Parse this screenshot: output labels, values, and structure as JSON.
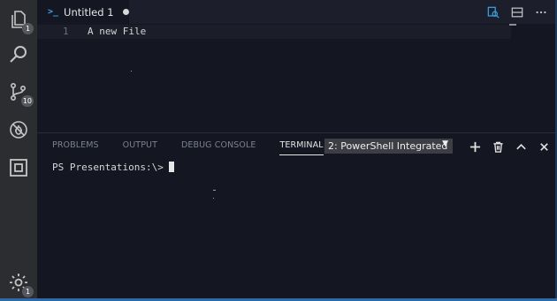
{
  "activity_bar": {
    "explorer_badge": "1",
    "scm_badge": "10",
    "settings_badge": "1"
  },
  "editor": {
    "tab": {
      "label": "Untitled 1",
      "icon": "powershell-icon",
      "dirty": true
    },
    "lines": [
      {
        "number": "1",
        "text": "A new File"
      }
    ]
  },
  "panel": {
    "tabs": [
      "PROBLEMS",
      "OUTPUT",
      "DEBUG CONSOLE",
      "TERMINAL"
    ],
    "active_tab": "TERMINAL",
    "terminal_select": {
      "value": "2: PowerShell Integrated",
      "caret": "▼"
    },
    "terminal": {
      "prompt": "PS Presentations:\\>"
    }
  },
  "colors": {
    "background": "#141622",
    "activity_bar": "#2c2d31",
    "accent_blue": "#3ba3e6",
    "status_bar": "#2c6aa8"
  }
}
